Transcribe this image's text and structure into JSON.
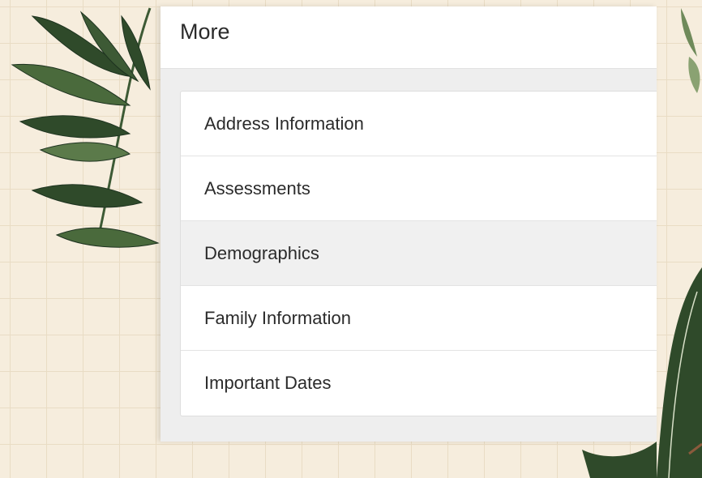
{
  "panel": {
    "title": "More"
  },
  "menu": {
    "items": [
      {
        "label": "Address Information",
        "active": false
      },
      {
        "label": "Assessments",
        "active": false
      },
      {
        "label": "Demographics",
        "active": true
      },
      {
        "label": "Family Information",
        "active": false
      },
      {
        "label": "Important Dates",
        "active": false
      }
    ]
  },
  "decor": {
    "leaf_dark": "#2f4a2a",
    "leaf_light": "#6f8a5a",
    "grid_line": "#e9dcc4",
    "background": "#f6eddd"
  }
}
